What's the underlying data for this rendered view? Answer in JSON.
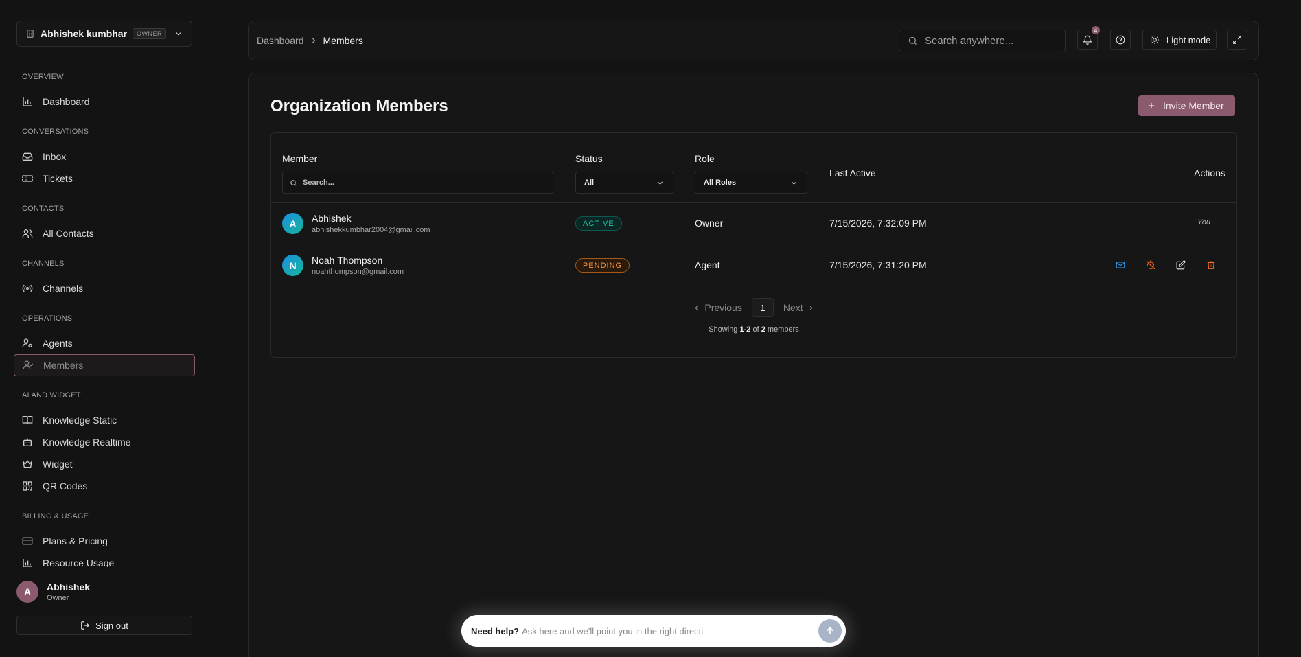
{
  "sidebar": {
    "org": {
      "name": "Abhishek kumbhar",
      "badge": "OWNER"
    },
    "sections": [
      {
        "title": "OVERVIEW",
        "items": [
          {
            "label": "Dashboard",
            "icon": "bar-chart-icon"
          }
        ]
      },
      {
        "title": "CONVERSATIONS",
        "items": [
          {
            "label": "Inbox",
            "icon": "inbox-icon"
          },
          {
            "label": "Tickets",
            "icon": "ticket-icon"
          }
        ]
      },
      {
        "title": "CONTACTS",
        "items": [
          {
            "label": "All Contacts",
            "icon": "users-icon"
          }
        ]
      },
      {
        "title": "CHANNELS",
        "items": [
          {
            "label": "Channels",
            "icon": "radio-icon"
          }
        ]
      },
      {
        "title": "OPERATIONS",
        "items": [
          {
            "label": "Agents",
            "icon": "user-cog-icon"
          },
          {
            "label": "Members",
            "icon": "user-check-icon",
            "active": true
          }
        ]
      },
      {
        "title": "AI AND WIDGET",
        "items": [
          {
            "label": "Knowledge Static",
            "icon": "book-icon"
          },
          {
            "label": "Knowledge Realtime",
            "icon": "bot-icon"
          },
          {
            "label": "Widget",
            "icon": "crown-icon"
          },
          {
            "label": "QR Codes",
            "icon": "qr-code-icon"
          }
        ]
      },
      {
        "title": "BILLING & USAGE",
        "items": [
          {
            "label": "Plans & Pricing",
            "icon": "credit-card-icon"
          },
          {
            "label": "Resource Usage",
            "icon": "bar-chart-icon"
          }
        ]
      }
    ],
    "user": {
      "initial": "A",
      "name": "Abhishek",
      "role": "Owner"
    },
    "sign_out": "Sign out"
  },
  "topbar": {
    "breadcrumb": {
      "parent": "Dashboard",
      "current": "Members"
    },
    "search_placeholder": "Search anywhere...",
    "notification_count": "4",
    "theme_label": "Light mode"
  },
  "main": {
    "title": "Organization Members",
    "invite_label": "Invite Member",
    "columns": {
      "member": "Member",
      "status": "Status",
      "role": "Role",
      "last_active": "Last Active",
      "actions": "Actions"
    },
    "filters": {
      "search_placeholder": "Search...",
      "status_value": "All",
      "role_value": "All Roles"
    },
    "members": [
      {
        "initial": "A",
        "name": "Abhishek",
        "email": "abhishekkumbhar2004@gmail.com",
        "status": "ACTIVE",
        "role": "Owner",
        "last_active": "7/15/2026, 7:32:09 PM",
        "actions_text": "You"
      },
      {
        "initial": "N",
        "name": "Noah Thompson",
        "email": "noahthompson@gmail.com",
        "status": "PENDING",
        "role": "Agent",
        "last_active": "7/15/2026, 7:31:20 PM",
        "actions_text": ""
      }
    ],
    "pagination": {
      "previous": "Previous",
      "next": "Next",
      "page": "1",
      "showing_prefix": "Showing",
      "showing_range": "1-2",
      "showing_of": "of",
      "showing_total": "2",
      "showing_suffix": "members"
    }
  },
  "help": {
    "label": "Need help?",
    "placeholder": "Ask here and we'll point you in the right directi"
  },
  "colors": {
    "accent": "#8c5a6e",
    "active_status": "#22c6ad",
    "pending_status": "#ff9a3c",
    "mail_action": "#2a9df4",
    "danger_action": "#ff6a1a"
  }
}
